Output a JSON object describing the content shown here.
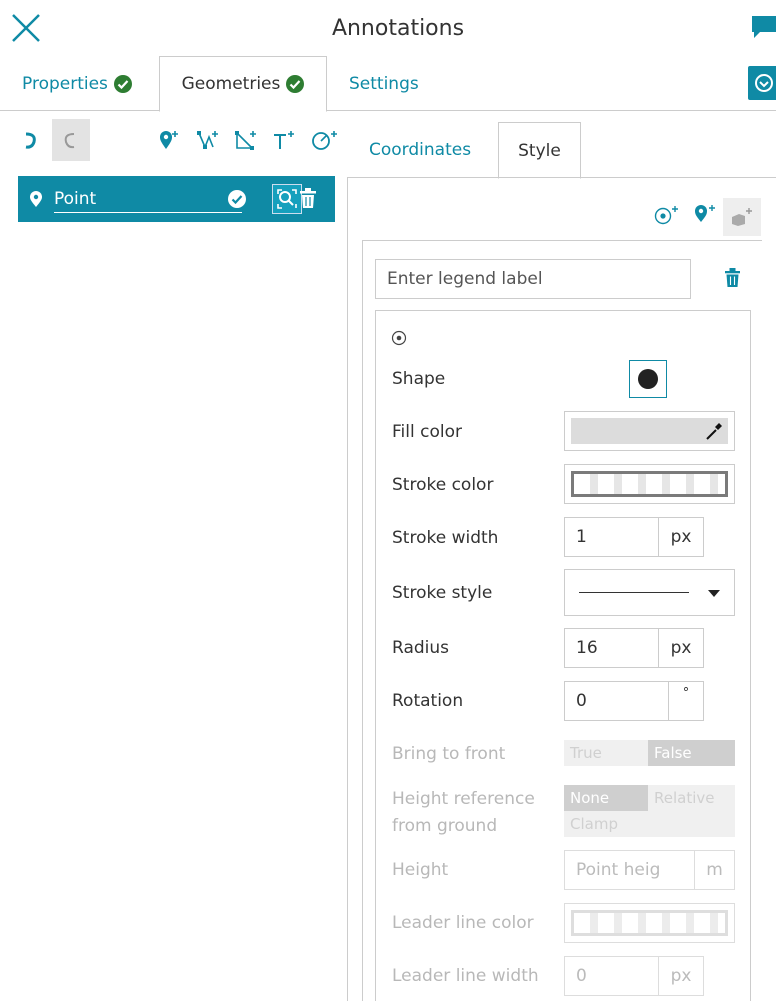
{
  "header": {
    "title": "Annotations"
  },
  "tabs": [
    {
      "label": "Properties",
      "status": "valid"
    },
    {
      "label": "Geometries",
      "status": "valid",
      "active": true
    },
    {
      "label": "Settings"
    }
  ],
  "toolbar": {
    "icons": [
      "undo-icon",
      "redo-icon",
      "add-point-icon",
      "add-line-icon",
      "add-polygon-icon",
      "add-text-icon",
      "add-circle-icon"
    ]
  },
  "geometries": [
    {
      "label": "Point",
      "selected": true
    }
  ],
  "subtabs": [
    {
      "label": "Coordinates"
    },
    {
      "label": "Style",
      "active": true
    }
  ],
  "style": {
    "legend_placeholder": "Enter legend label",
    "shape_label": "Shape",
    "fill_color_label": "Fill color",
    "stroke_color_label": "Stroke color",
    "stroke_width_label": "Stroke width",
    "stroke_width_value": "1",
    "stroke_width_unit": "px",
    "stroke_style_label": "Stroke style",
    "radius_label": "Radius",
    "radius_value": "16",
    "radius_unit": "px",
    "rotation_label": "Rotation",
    "rotation_value": "0",
    "rotation_unit": "°",
    "bring_to_front_label": "Bring to front",
    "bring_to_front_true": "True",
    "bring_to_front_false": "False",
    "height_ref_label_1": "Height reference",
    "height_ref_label_2": "from ground",
    "height_ref_none": "None",
    "height_ref_relative": "Relative",
    "height_ref_clamp": "Clamp",
    "height_label": "Height",
    "height_placeholder": "Point heig",
    "height_unit": "m",
    "leader_line_color_label": "Leader line color",
    "leader_line_width_label": "Leader line width",
    "leader_line_width_value": "0",
    "leader_line_width_unit": "px"
  },
  "colors": {
    "accent": "#0f8aa5",
    "check_green": "#2e7d32"
  }
}
